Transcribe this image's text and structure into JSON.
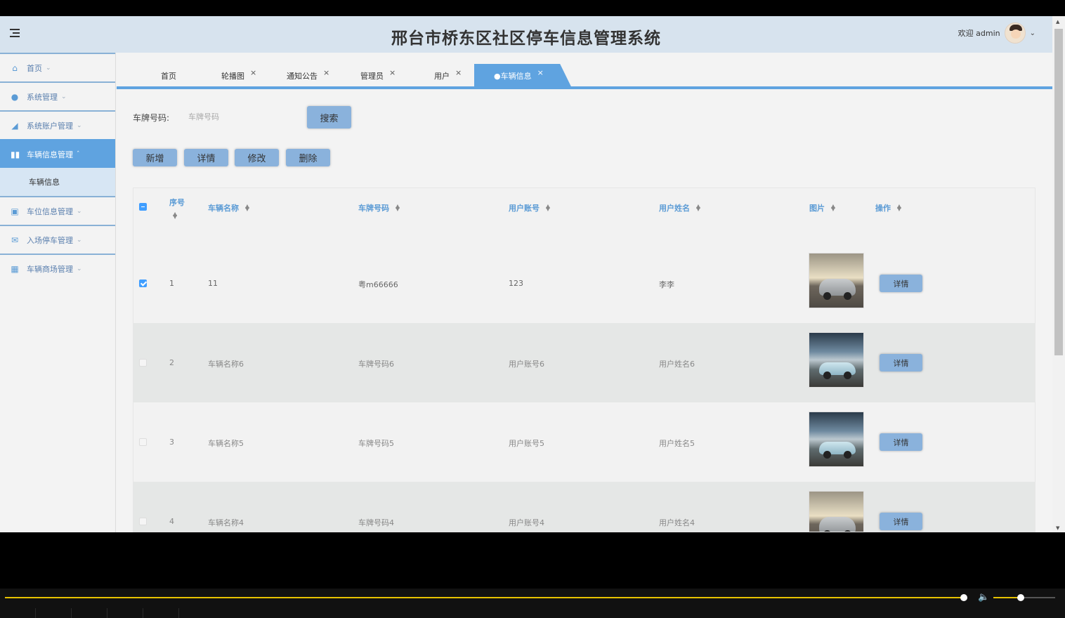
{
  "header": {
    "title": "邢台市桥东区社区停车信息管理系统",
    "welcome": "欢迎 admin",
    "menu_icon": "menu-fold-icon",
    "avatar_icon": "user-avatar",
    "dropdown_icon": "chevron-down-icon"
  },
  "sidebar": {
    "items": [
      {
        "label": "首页",
        "icon": "home-icon",
        "expanded": false
      },
      {
        "label": "系统管理",
        "icon": "settings-icon",
        "expanded": false
      },
      {
        "label": "系统账户管理",
        "icon": "account-icon",
        "expanded": false
      },
      {
        "label": "车辆信息管理",
        "icon": "vehicle-icon",
        "expanded": true,
        "active": true
      },
      {
        "label": "车位信息管理",
        "icon": "parking-icon",
        "expanded": false
      },
      {
        "label": "入场停车管理",
        "icon": "entry-icon",
        "expanded": false
      },
      {
        "label": "车辆商场管理",
        "icon": "grid-icon",
        "expanded": false
      }
    ],
    "sub_items": [
      {
        "label": "车辆信息"
      }
    ]
  },
  "tabs": [
    {
      "label": "首页",
      "closable": false
    },
    {
      "label": "轮播图",
      "closable": true
    },
    {
      "label": "通知公告",
      "closable": true
    },
    {
      "label": "管理员",
      "closable": true
    },
    {
      "label": "用户",
      "closable": true
    },
    {
      "label": "●车辆信息",
      "closable": true,
      "active": true
    }
  ],
  "search": {
    "label": "车牌号码:",
    "placeholder": "车牌号码",
    "value": "",
    "button": "搜索"
  },
  "toolbar": {
    "add": "新增",
    "detail": "详情",
    "edit": "修改",
    "delete": "删除"
  },
  "table": {
    "columns": [
      "序号",
      "车辆名称",
      "车牌号码",
      "用户账号",
      "用户姓名",
      "图片",
      "操作"
    ],
    "rows": [
      {
        "index": "1",
        "name": "11",
        "plate": "粤m66666",
        "account": "123",
        "username": "李李",
        "image": "silver-car",
        "action": "详情",
        "checked": true
      },
      {
        "index": "2",
        "name": "车辆名称6",
        "plate": "车牌号码6",
        "account": "用户账号6",
        "username": "用户姓名6",
        "image": "blue-car",
        "action": "详情",
        "checked": false
      },
      {
        "index": "3",
        "name": "车辆名称5",
        "plate": "车牌号码5",
        "account": "用户账号5",
        "username": "用户姓名5",
        "image": "blue-car",
        "action": "详情",
        "checked": false
      },
      {
        "index": "4",
        "name": "车辆名称4",
        "plate": "车牌号码4",
        "account": "用户账号4",
        "username": "用户姓名4",
        "image": "silver-car",
        "action": "详情",
        "checked": false
      }
    ]
  },
  "player": {
    "progress": 0.9,
    "volume": 0.45
  },
  "colors": {
    "accent": "#5fa3e0",
    "header_bg": "#d7e3ee",
    "button_bg": "#8ab2dc",
    "progress": "#e6c200"
  }
}
